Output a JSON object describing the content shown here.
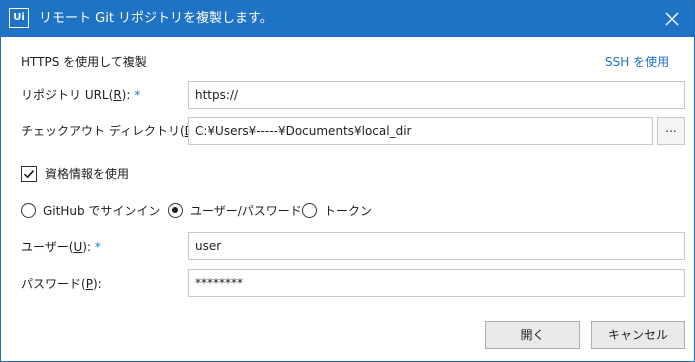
{
  "titlebar": {
    "app_icon_text": "Ui",
    "title": "リモート Git リポジトリを複製します。",
    "close_icon": "close-icon"
  },
  "section": {
    "heading": "HTTPS を使用して複製",
    "ssh_link": "SSH を使用"
  },
  "repo_url": {
    "label_pre": "リポジトリ URL(",
    "accel": "R",
    "label_post": "):",
    "required": "*",
    "value": "https://"
  },
  "checkout_dir": {
    "label_pre": "チェックアウト ディレクトリ(",
    "accel": "D",
    "label_post": "):",
    "required": "*",
    "value": "C:¥Users¥-----¥Documents¥local_dir",
    "browse_label": "..."
  },
  "credentials": {
    "checkbox_label": "資格情報を使用",
    "checked": true
  },
  "auth_options": {
    "options": [
      "GitHub でサインイン",
      "ユーザー/パスワード",
      "トークン"
    ],
    "selected": "ユーザー/パスワード"
  },
  "user": {
    "label_pre": "ユーザー(",
    "accel": "U",
    "label_post": "):",
    "required": "*",
    "value": "user"
  },
  "password": {
    "label_pre": "パスワード(",
    "accel": "P",
    "label_post": "):",
    "value": "********"
  },
  "footer": {
    "open_label": "開く",
    "cancel_label": "キャンセル"
  },
  "colors": {
    "titlebar": "#1e73c4",
    "accent": "#1e73c4",
    "border": "#c8c8c8"
  }
}
